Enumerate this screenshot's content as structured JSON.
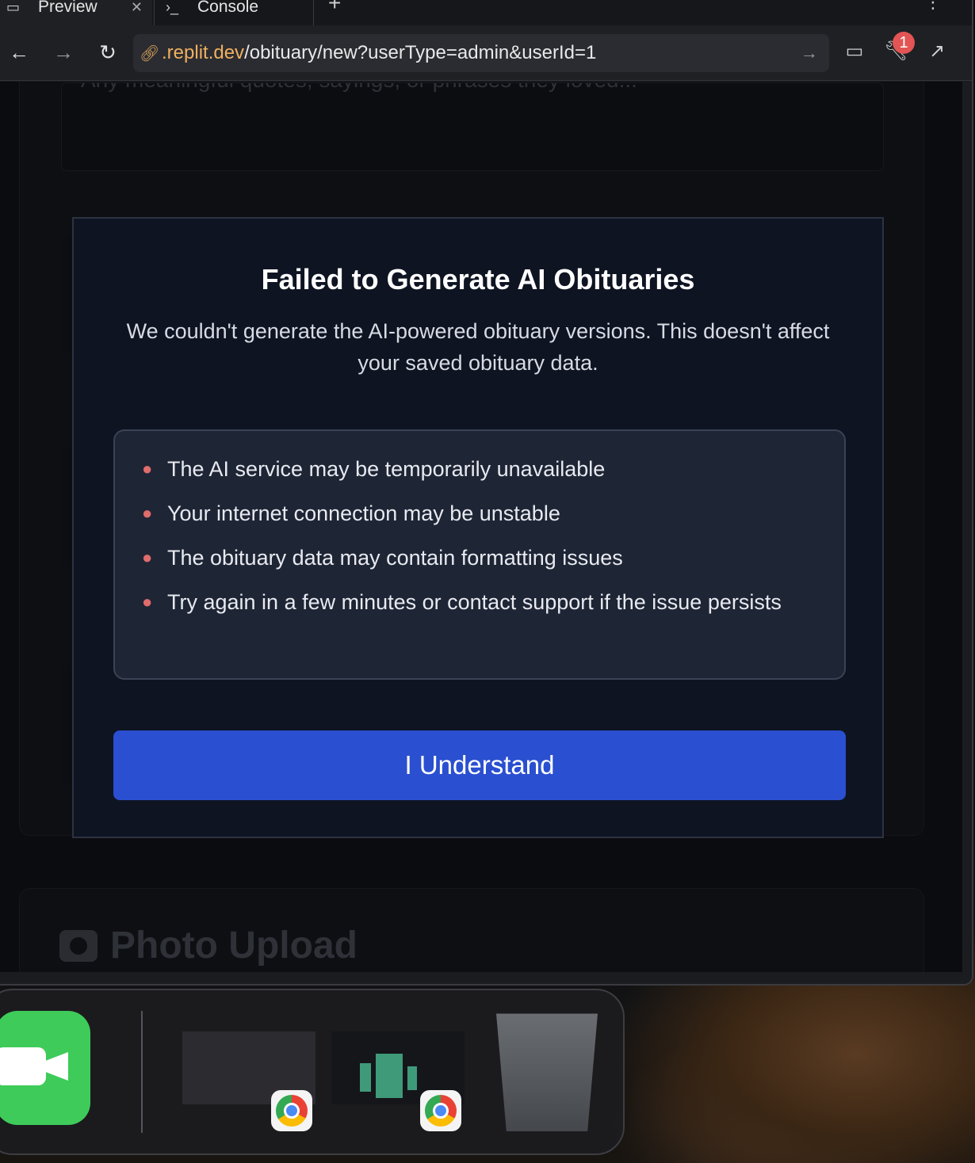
{
  "browser": {
    "tabs": [
      {
        "label": "Preview",
        "icon": "monitor-icon"
      },
      {
        "label": "Console",
        "icon": "terminal-icon"
      }
    ],
    "url": {
      "host": ".replit.dev",
      "path": "/obituary/new?userType=admin&userId=1"
    },
    "devtools_badge": "1"
  },
  "page": {
    "textarea_placeholder": "Any meaningful quotes, sayings, or phrases they loved...",
    "photo_upload_title": "Photo Upload"
  },
  "modal": {
    "title": "Failed to Generate AI Obituaries",
    "description": "We couldn't generate the AI-powered obituary versions. This doesn't affect your saved obituary data.",
    "reasons": [
      "The AI service may be temporarily unavailable",
      "Your internet connection may be unstable",
      "The obituary data may contain formatting issues",
      "Try again in a few minutes or contact support if the issue persists"
    ],
    "confirm_label": "I Understand"
  },
  "colors": {
    "modal_bg": "#0e1422",
    "reasons_bg": "#1e2535",
    "bullet": "#e06c6c",
    "button": "#2a4fd0",
    "url_host": "#f0b060"
  }
}
